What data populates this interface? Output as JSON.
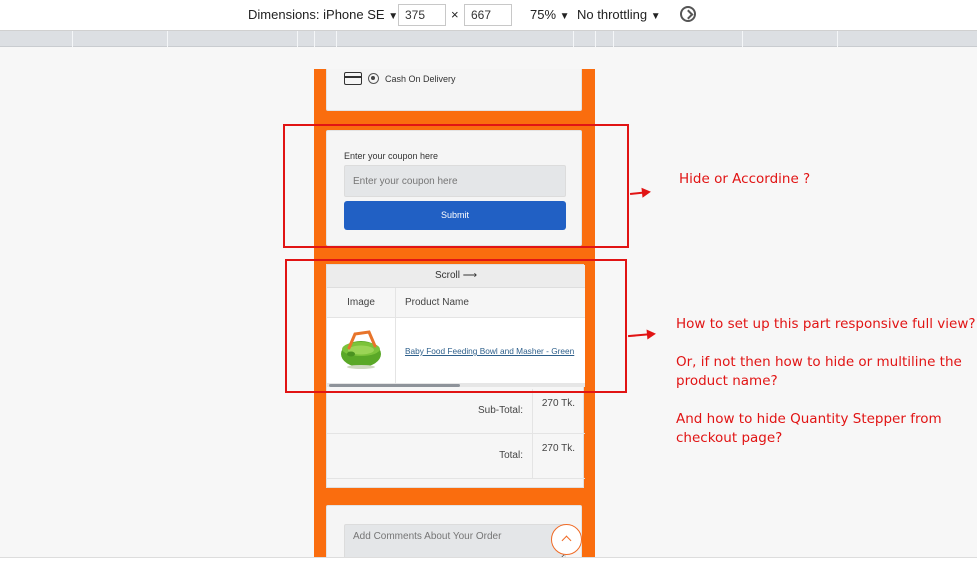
{
  "devtools": {
    "dimensions_label": "Dimensions: iPhone SE",
    "width": "375",
    "height": "667",
    "times": "×",
    "zoom": "75%",
    "throttling": "No throttling",
    "caret": "▼"
  },
  "payment": {
    "method_label": "Cash On Delivery"
  },
  "coupon": {
    "label": "Enter your coupon here",
    "placeholder": "Enter your coupon here",
    "submit_label": "Submit",
    "submit_color": "#2160c4"
  },
  "cart_table": {
    "scroll_hint": "Scroll ⟶",
    "columns": [
      "Image",
      "Product Name"
    ],
    "rows": [
      {
        "product_name": "Baby Food Feeding Bowl and Masher - Green"
      }
    ],
    "subtotal_label": "Sub-Total:",
    "subtotal_value": "270 Tk.",
    "total_label": "Total:",
    "total_value": "270 Tk."
  },
  "comments": {
    "placeholder": "Add Comments About Your Order"
  },
  "annotations": {
    "note_1": "Hide or Accordine ?",
    "note_2_line_1": "How to set up this part responsive full view?",
    "note_2_line_2": "Or, if not then how to hide or multiline the",
    "note_2_line_3": "product name?",
    "note_2_line_4": "And how to hide Quantity Stepper from",
    "note_2_line_5": "checkout page?",
    "color": "#e11414"
  },
  "theme": {
    "brand_orange": "#fa6d0e"
  }
}
